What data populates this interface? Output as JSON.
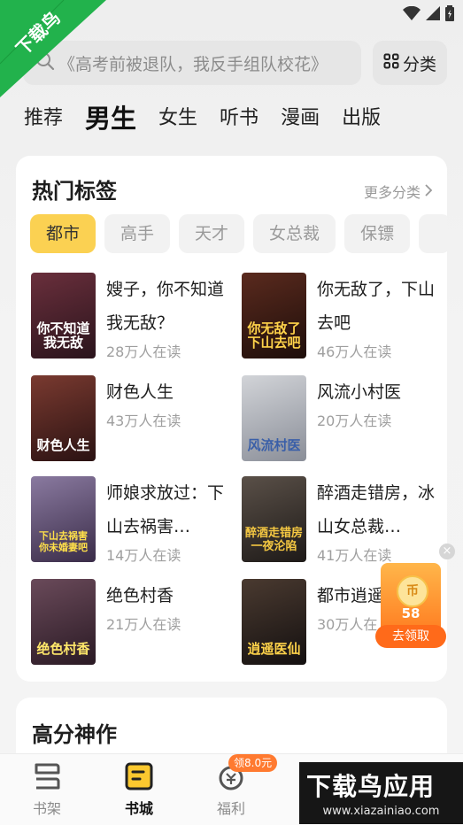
{
  "watermark_corner": {
    "text": "下载鸟",
    "color": "#21b34a"
  },
  "search": {
    "placeholder": "《高考前被退队，我反手组队校花》"
  },
  "category_button": {
    "label": "分类"
  },
  "channels": [
    {
      "label": "推荐",
      "active": false
    },
    {
      "label": "男生",
      "active": true
    },
    {
      "label": "女生",
      "active": false
    },
    {
      "label": "听书",
      "active": false
    },
    {
      "label": "漫画",
      "active": false
    },
    {
      "label": "出版",
      "active": false
    }
  ],
  "hot_tags": {
    "title": "热门标签",
    "more": "更多分类",
    "tags": [
      "都市",
      "高手",
      "天才",
      "女总裁",
      "保镖",
      ""
    ]
  },
  "books": [
    {
      "title": "嫂子，你不知道我无敌？",
      "readers": "28万人在读",
      "cover_text": "你不知道我无敌",
      "cover_bg": "#3a1e2a",
      "cover_fg": "#ffffff"
    },
    {
      "title": "你无敌了，下山去吧",
      "readers": "46万人在读",
      "cover_text": "你无敌了下山去吧",
      "cover_bg": "#2a1410",
      "cover_fg": "#ffd34a"
    },
    {
      "title": "财色人生",
      "readers": "43万人在读",
      "cover_text": "财色人生",
      "cover_bg": "#3a1c1c",
      "cover_fg": "#ffffff"
    },
    {
      "title": "风流小村医",
      "readers": "20万人在读",
      "cover_text": "风流村医",
      "cover_bg": "#b8bcc4",
      "cover_fg": "#3a5fa8"
    },
    {
      "title": "师娘求放过：下山去祸害…",
      "readers": "14万人在读",
      "cover_text": "下山去祸害你未婚妻吧",
      "cover_bg": "#4a3a5a",
      "cover_fg": "#ffe04a"
    },
    {
      "title": "醉酒走错房，冰山女总裁…",
      "readers": "41万人在读",
      "cover_text": "醉酒走错房 一夜沦陷",
      "cover_bg": "#2c2a28",
      "cover_fg": "#f5c842"
    },
    {
      "title": "绝色村香",
      "readers": "21万人在读",
      "cover_text": "绝色村香",
      "cover_bg": "#3a2a3a",
      "cover_fg": "#ffe86a"
    },
    {
      "title": "都市逍遥",
      "readers": "30万人在",
      "cover_text": "逍遥医仙",
      "cover_bg": "#1c1a1a",
      "cover_fg": "#ffd34a"
    }
  ],
  "reward": {
    "value": "58",
    "button": "去领取",
    "coin": "币"
  },
  "high_score": {
    "title": "高分神作"
  },
  "bottom_nav": [
    {
      "label": "书架",
      "active": false
    },
    {
      "label": "书城",
      "active": true
    },
    {
      "label": "福利",
      "active": false
    }
  ],
  "nav_badge": "领8.0元",
  "watermark_bottom": {
    "brand": "下载鸟应用",
    "url": "www.xiazainiao.com"
  }
}
